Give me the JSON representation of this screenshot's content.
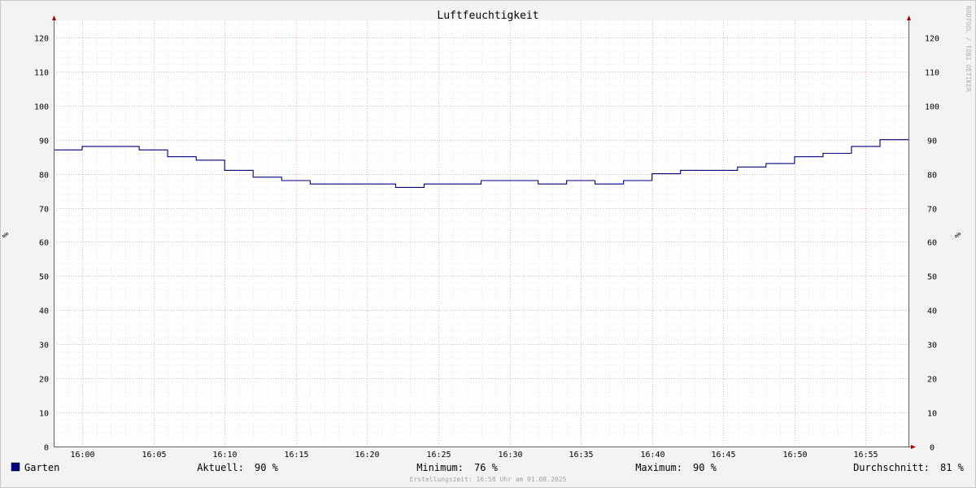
{
  "chart_data": {
    "type": "line",
    "title": "Luftfeuchtigkeit",
    "ylabel": "%",
    "ylabel_right": "%",
    "ylim": [
      0,
      125
    ],
    "yticks": [
      0,
      10,
      20,
      30,
      40,
      50,
      60,
      70,
      80,
      90,
      100,
      110,
      120
    ],
    "x_range_minutes": [
      -2,
      58
    ],
    "xticks": [
      "16:00",
      "16:05",
      "16:10",
      "16:15",
      "16:20",
      "16:25",
      "16:30",
      "16:35",
      "16:40",
      "16:45",
      "16:50",
      "16:55"
    ],
    "grid": true,
    "watermark": "RRDTOOL / TOBI OETIKER",
    "series": [
      {
        "name": "Garten",
        "color": "#000080",
        "step": true,
        "x": [
          "15:58",
          "16:00",
          "16:04",
          "16:06",
          "16:08",
          "16:10",
          "16:12",
          "16:14",
          "16:16",
          "16:22",
          "16:24",
          "16:28",
          "16:32",
          "16:34",
          "16:36",
          "16:38",
          "16:40",
          "16:42",
          "16:46",
          "16:48",
          "16:50",
          "16:52",
          "16:54",
          "16:56",
          "16:58"
        ],
        "values": [
          87,
          88,
          87,
          85,
          84,
          81,
          79,
          78,
          77,
          76,
          77,
          78,
          77,
          78,
          77,
          78,
          80,
          81,
          82,
          83,
          85,
          86,
          88,
          90,
          90
        ]
      }
    ],
    "legend": {
      "name": "Garten",
      "color": "#000080",
      "stats": [
        {
          "label": "Aktuell:",
          "value": "90 %"
        },
        {
          "label": "Minimum:",
          "value": "76 %"
        },
        {
          "label": "Maximum:",
          "value": "90 %"
        },
        {
          "label": "Durchschnitt:",
          "value": "81 %"
        }
      ]
    },
    "footer": "Erstellungszeit: 16:58 Uhr am 01.08.2025"
  }
}
